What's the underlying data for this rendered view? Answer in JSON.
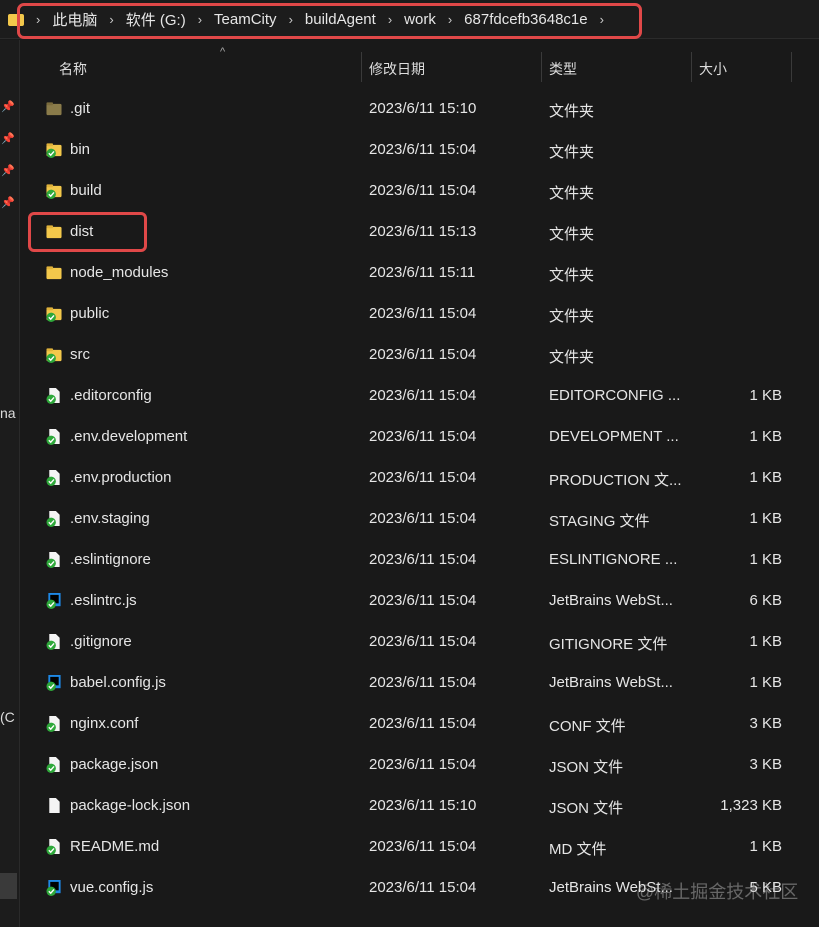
{
  "breadcrumb": [
    "此电脑",
    "软件 (G:)",
    "TeamCity",
    "buildAgent",
    "work",
    "687fdcefb3648c1e"
  ],
  "sidebar": {
    "partial_texts": [
      "na",
      "(C"
    ]
  },
  "columns": {
    "name": "名称",
    "date": "修改日期",
    "type": "类型",
    "size": "大小"
  },
  "files": [
    {
      "name": ".git",
      "date": "2023/6/11 15:10",
      "type": "文件夹",
      "size": "",
      "icon": "folder-dark"
    },
    {
      "name": "bin",
      "date": "2023/6/11 15:04",
      "type": "文件夹",
      "size": "",
      "icon": "folder-synced"
    },
    {
      "name": "build",
      "date": "2023/6/11 15:04",
      "type": "文件夹",
      "size": "",
      "icon": "folder-synced"
    },
    {
      "name": "dist",
      "date": "2023/6/11 15:13",
      "type": "文件夹",
      "size": "",
      "icon": "folder"
    },
    {
      "name": "node_modules",
      "date": "2023/6/11 15:11",
      "type": "文件夹",
      "size": "",
      "icon": "folder"
    },
    {
      "name": "public",
      "date": "2023/6/11 15:04",
      "type": "文件夹",
      "size": "",
      "icon": "folder-synced"
    },
    {
      "name": "src",
      "date": "2023/6/11 15:04",
      "type": "文件夹",
      "size": "",
      "icon": "folder-synced"
    },
    {
      "name": ".editorconfig",
      "date": "2023/6/11 15:04",
      "type": "EDITORCONFIG ...",
      "size": "1 KB",
      "icon": "file-synced"
    },
    {
      "name": ".env.development",
      "date": "2023/6/11 15:04",
      "type": "DEVELOPMENT ...",
      "size": "1 KB",
      "icon": "file-synced"
    },
    {
      "name": ".env.production",
      "date": "2023/6/11 15:04",
      "type": "PRODUCTION 文...",
      "size": "1 KB",
      "icon": "file-synced"
    },
    {
      "name": ".env.staging",
      "date": "2023/6/11 15:04",
      "type": "STAGING 文件",
      "size": "1 KB",
      "icon": "file-synced"
    },
    {
      "name": ".eslintignore",
      "date": "2023/6/11 15:04",
      "type": "ESLINTIGNORE ...",
      "size": "1 KB",
      "icon": "file-synced"
    },
    {
      "name": ".eslintrc.js",
      "date": "2023/6/11 15:04",
      "type": "JetBrains WebSt...",
      "size": "6 KB",
      "icon": "webstorm-synced"
    },
    {
      "name": ".gitignore",
      "date": "2023/6/11 15:04",
      "type": "GITIGNORE 文件",
      "size": "1 KB",
      "icon": "file-synced"
    },
    {
      "name": "babel.config.js",
      "date": "2023/6/11 15:04",
      "type": "JetBrains WebSt...",
      "size": "1 KB",
      "icon": "webstorm-synced"
    },
    {
      "name": "nginx.conf",
      "date": "2023/6/11 15:04",
      "type": "CONF 文件",
      "size": "3 KB",
      "icon": "file-synced"
    },
    {
      "name": "package.json",
      "date": "2023/6/11 15:04",
      "type": "JSON 文件",
      "size": "3 KB",
      "icon": "file-synced"
    },
    {
      "name": "package-lock.json",
      "date": "2023/6/11 15:10",
      "type": "JSON 文件",
      "size": "1,323 KB",
      "icon": "file"
    },
    {
      "name": "README.md",
      "date": "2023/6/11 15:04",
      "type": "MD 文件",
      "size": "1 KB",
      "icon": "file-synced"
    },
    {
      "name": "vue.config.js",
      "date": "2023/6/11 15:04",
      "type": "JetBrains WebSt...",
      "size": "5 KB",
      "icon": "webstorm-synced"
    }
  ],
  "watermark": "@稀土掘金技术社区",
  "colors": {
    "highlight": "#e04848",
    "background": "#191919",
    "folder": "#f3c84b",
    "sync_check": "#2ea83a"
  }
}
